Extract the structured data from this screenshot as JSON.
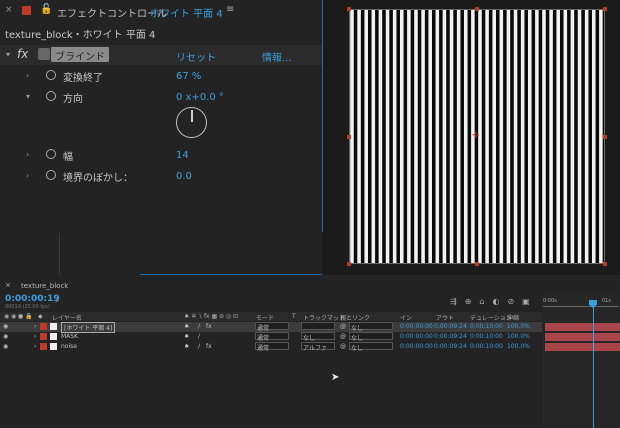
{
  "effect_controls": {
    "title": "エフェクトコントロール",
    "layer": "ホワイト 平面 4",
    "subtitle": "texture_block・ホワイト 平面 4",
    "effect_name": "ブラインド",
    "fx": "fx",
    "reset": "リセット",
    "info": "情報...",
    "props": [
      {
        "label": "変換終了",
        "value": "67 %"
      },
      {
        "label": "方向",
        "value": "0 x+0.0 °"
      },
      {
        "label": "幅",
        "value": "14"
      },
      {
        "label": "境界のぼかし：",
        "value": "0.0"
      }
    ],
    "accent_color": "#3d9fe0"
  },
  "timeline": {
    "tab": "texture_block",
    "timecode": "0:00:00:19",
    "frames": "00019 (25.00 fps)",
    "search_placeholder": "⌕",
    "headers": {
      "layer_name": "レイヤー名",
      "mode": "モード",
      "t": "T",
      "track_matte": "トラックマット",
      "parent": "親とリンク",
      "in": "イン",
      "out": "アウト",
      "duration": "デュレーション",
      "stretch": "伸縮"
    },
    "ruler": {
      "start": "0:00s",
      "mark": "01s"
    },
    "layers": [
      {
        "name": "[ホワイト 平面 4]",
        "mode": "通常",
        "matte": "",
        "parent": "なし",
        "in": "0:00:00:00",
        "out": "0:00:09:24",
        "dur": "0:00:10:00",
        "stretch": "100.0%",
        "color": "#c03a2b",
        "selected": true,
        "fx": "fx"
      },
      {
        "name": "MASK",
        "mode": "通常",
        "matte": "なし",
        "parent": "なし",
        "in": "0:00:00:00",
        "out": "0:00:09:24",
        "dur": "0:00:10:00",
        "stretch": "100.0%",
        "color": "#c03a2b",
        "selected": false,
        "fx": ""
      },
      {
        "name": "noise",
        "mode": "通常",
        "matte": "アルファ",
        "parent": "なし",
        "in": "0:00:00:00",
        "out": "0:00:09:24",
        "dur": "0:00:10:00",
        "stretch": "100.0%",
        "color": "#c03a2b",
        "selected": false,
        "fx": "fx"
      }
    ]
  }
}
